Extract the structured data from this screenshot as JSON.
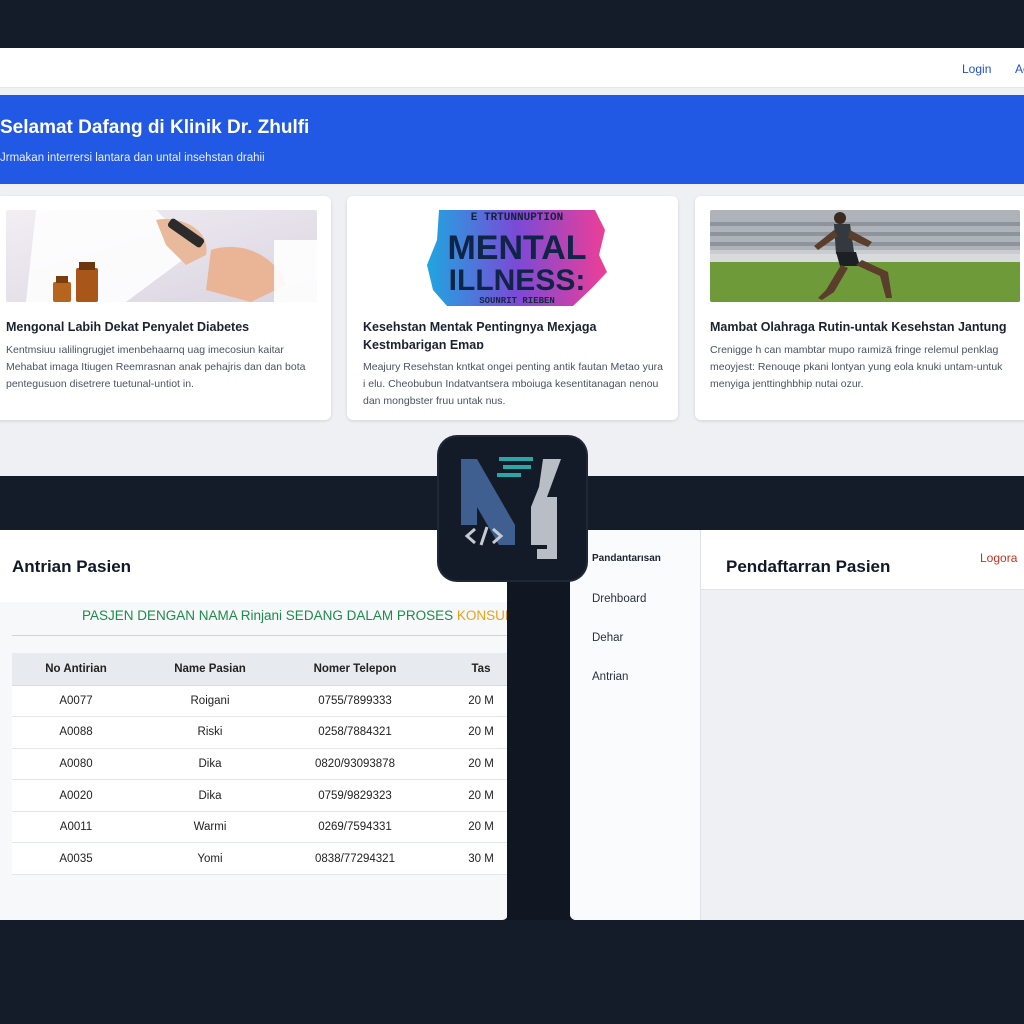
{
  "navbar": {
    "login_label": "Login",
    "other_label": "Ac"
  },
  "hero": {
    "title": "Selamat Dafang di Klinik Dr. Zhulfi",
    "subtitle": "Jrmakan interrersi lantara dan untal insehstan drahii"
  },
  "articles": [
    {
      "title": "Mengonal Labih Dekat Penyalet Diabetes",
      "text": "Kentmsiuu ıalilingrugjet imenbehaarnq uag imecosiun kaitar Mehabat imaga Itiugen Reemrasnan anak pehajris dan dan bota pentegusuon disetrere tuetunal-untiot in."
    },
    {
      "title": "Kesehstan Mentak Pentingnya Mexjaga Kestmbarigan Emaɒ",
      "text": "Meajury Resehstan kntkat ongei penting antik fautan Metao yura i elu. Cheobubun Indatvantsera mboiuga kesentitanagan nenou dan mongbster fruu untak nus.",
      "image_caption": "E TRTUNNUPTION MENTAL ILLNESS: SOUNRIT RIEBEN"
    },
    {
      "title": "Mambat Olahraga Rutin-untak Kesehstan Jantung",
      "text": "Crenigge h can mambtar mupo raımizä fringe relemul penklag meoyjest: Renouqe pkani lontyan yung eola knuki untam-untuk menyiga jenttinghbhip nutai ozur."
    }
  ],
  "queue": {
    "title": "Antrian Pasien",
    "status_prefix": "PASJEN DENGAN NAMA Rinjani SEDANG DALAM PROSES ",
    "status_highlight": "KONSULTA",
    "columns": [
      "No Antirian",
      "Name Pasian",
      "Nomer Telepon",
      "Tas"
    ],
    "rows": [
      [
        "A0077",
        "Roigani",
        "0755/7899333",
        "20 M"
      ],
      [
        "A0088",
        "Riski",
        "0258/7884321",
        "20 M"
      ],
      [
        "A0080",
        "Dika",
        "0820/93093878",
        "20 M"
      ],
      [
        "A0020",
        "Dika",
        "0759/9829323",
        "20 M"
      ],
      [
        "A0011",
        "Warmi",
        "0269/7594331",
        "20 M"
      ],
      [
        "A0035",
        "Yomi",
        "0838/77294321",
        "30 M"
      ]
    ]
  },
  "registration": {
    "brand": "Pandantarısan",
    "menu": [
      "Drehboard",
      "Dehar",
      "Antrian"
    ],
    "title": "Pendaftarran Pasien",
    "logout_label": "Logora"
  },
  "colors": {
    "hero_blue": "#2158e4",
    "status_green": "#1e8a4c",
    "status_orange": "#e8a21c",
    "logout_red": "#c8321f",
    "logo_blue": "#3e5f8f",
    "logo_gray": "#b9bec6",
    "logo_teal": "#2aa5a8"
  }
}
